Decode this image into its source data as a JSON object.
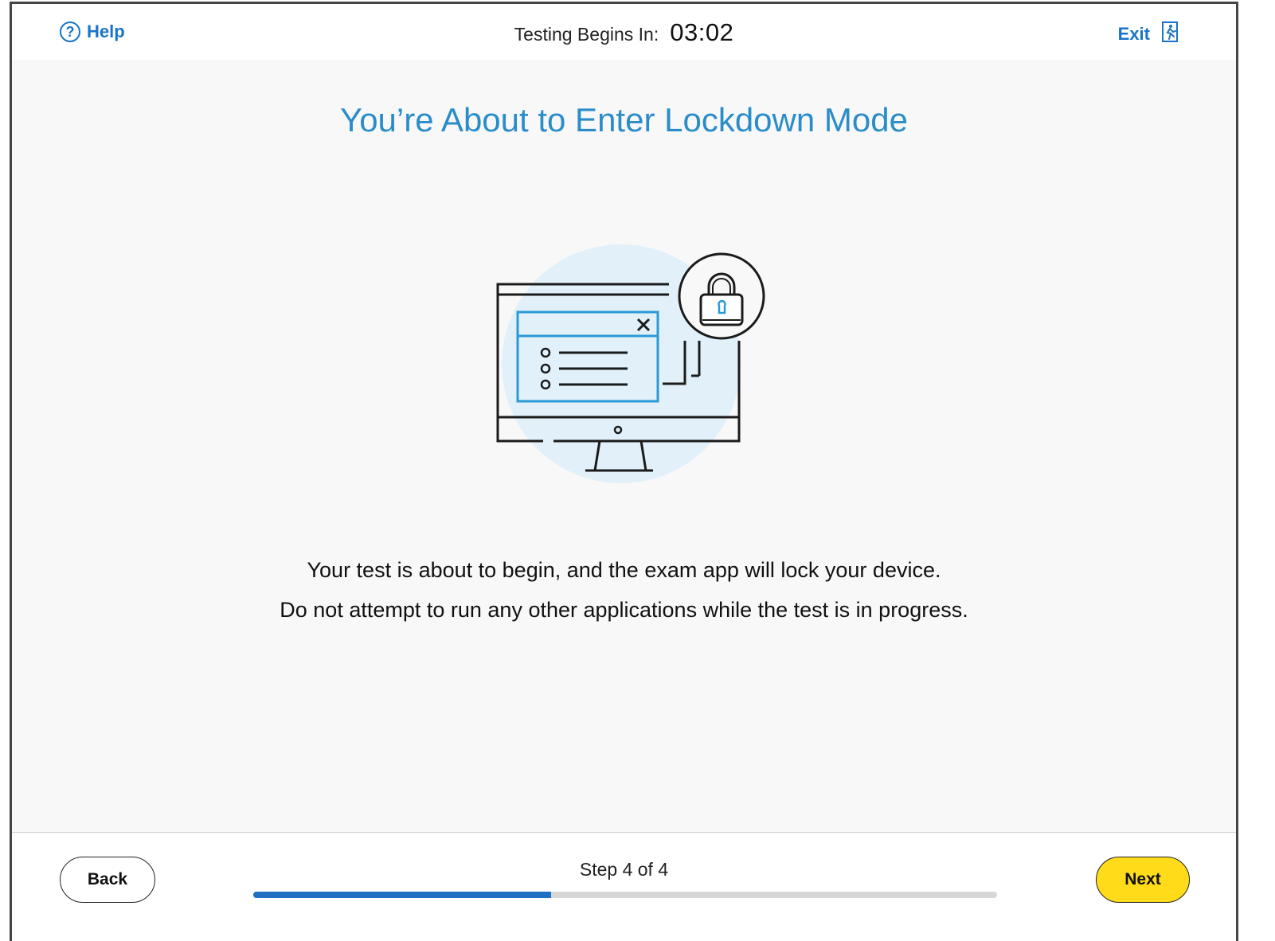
{
  "header": {
    "help_label": "Help",
    "help_icon": "question-circle-icon",
    "timer_label": "Testing Begins In:",
    "timer_value": "03:02",
    "exit_label": "Exit",
    "exit_icon": "exit-door-icon"
  },
  "main": {
    "title": "You’re About to Enter Lockdown Mode",
    "illustration_icon": "locked-monitor-icon",
    "message_line1": "Your test is about to begin, and the exam app will lock your device.",
    "message_line2": "Do not attempt to run any other applications while the test is in progress."
  },
  "footer": {
    "back_label": "Back",
    "next_label": "Next",
    "step_label": "Step 4 of 4",
    "progress_fraction": 0.4
  },
  "colors": {
    "accent_blue": "#1a73c8",
    "title_blue": "#2a8dc9",
    "next_yellow": "#ffdb1a",
    "progress_blue": "#1f6fc3",
    "illustration_circle": "#e1f0f9"
  }
}
